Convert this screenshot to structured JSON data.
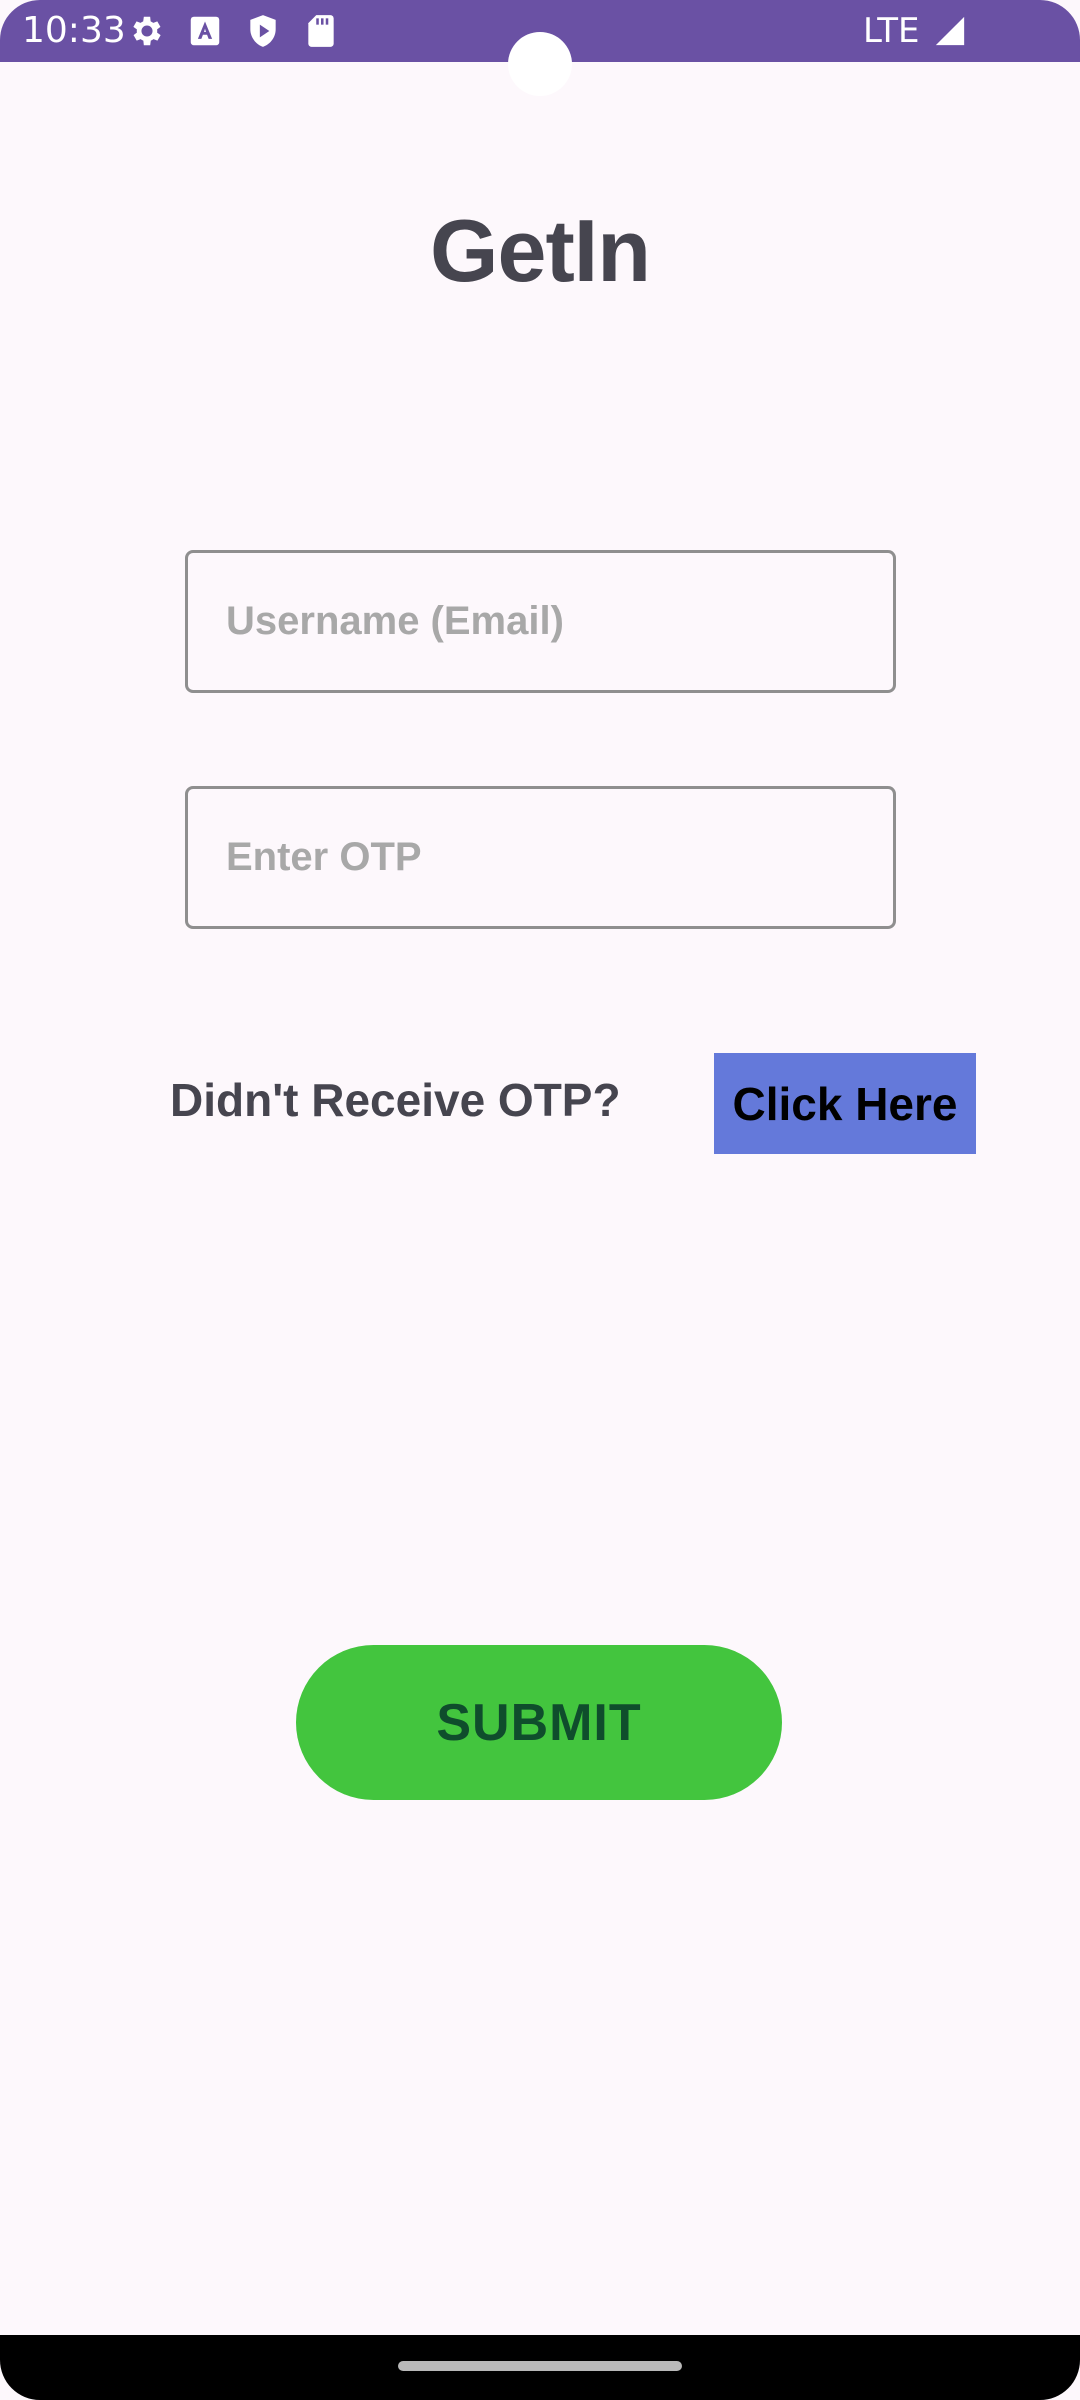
{
  "status_bar": {
    "time": "10:33",
    "network": "LTE",
    "icons": [
      "settings-icon",
      "font-a-icon",
      "play-shield-icon",
      "sd-card-icon",
      "signal-icon"
    ],
    "color": "#6a51a4"
  },
  "app": {
    "title": "GetIn"
  },
  "form": {
    "username_placeholder": "Username (Email)",
    "username_value": "",
    "otp_placeholder": "Enter OTP",
    "otp_value": ""
  },
  "resend": {
    "label": "Didn't Receive OTP?",
    "button_label": "Click Here",
    "button_color": "#6479da"
  },
  "submit": {
    "label": "SUBMIT",
    "color": "#43c53e"
  }
}
